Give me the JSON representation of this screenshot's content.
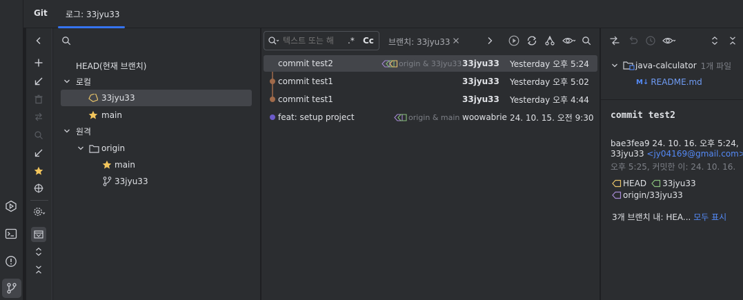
{
  "tabs": {
    "tool_window": "Git",
    "log_tab": "로그: 33jyu33"
  },
  "branches": {
    "head": "HEAD(현재 브랜치)",
    "local_group": "로컬",
    "local": [
      "33jyu33",
      "main"
    ],
    "remote_group": "원격",
    "remote_folder": "origin",
    "remote": [
      "main",
      "33jyu33"
    ]
  },
  "log": {
    "filter_placeholder": "텍스트 또는 해",
    "regex_label": ".*",
    "case_label": "Cc",
    "branch_filter": "브랜치: 33jyu33",
    "commits": [
      {
        "message": "commit test2",
        "refs": "origin & 33jyu33",
        "author": "33jyu33",
        "date": "Yesterday 오후 5:24"
      },
      {
        "message": "commit test1",
        "refs": "",
        "author": "33jyu33",
        "date": "Yesterday 오후 5:02"
      },
      {
        "message": "commit test1",
        "refs": "",
        "author": "33jyu33",
        "date": "Yesterday 오후 4:44"
      },
      {
        "message": "feat: setup project",
        "refs": "origin & main",
        "author": "woowabrie",
        "date": "24. 10. 15. 오전 9:30"
      }
    ]
  },
  "details": {
    "repo_name": "java-calculator",
    "file_count": "1개 파일",
    "file_prefix": "M↓",
    "file_name": "README.md",
    "commit_title": "commit test2",
    "hash_line": "bae3fea9 24. 10. 16. 오후 5:24,",
    "author_name": "33jyu33",
    "author_email": "<jy04169@gmail.com>",
    "committed_line": "오후 5:25, 커밋한 이: 24. 10. 16.",
    "ref_head": "HEAD",
    "ref_branch": "33jyu33",
    "ref_remote": "origin/33jyu33",
    "contained_in": "3개 브랜치 내: HEA...",
    "show_all": "모두 표시"
  },
  "colors": {
    "accent": "#3574f0",
    "link": "#548af7",
    "tag_yellow": "#e8c46a",
    "tag_green": "#89c07b",
    "tag_purple": "#a78bd6",
    "graph_brown": "#a06a4a",
    "graph_blue": "#6c5bc9",
    "star": "#f2c55c"
  }
}
